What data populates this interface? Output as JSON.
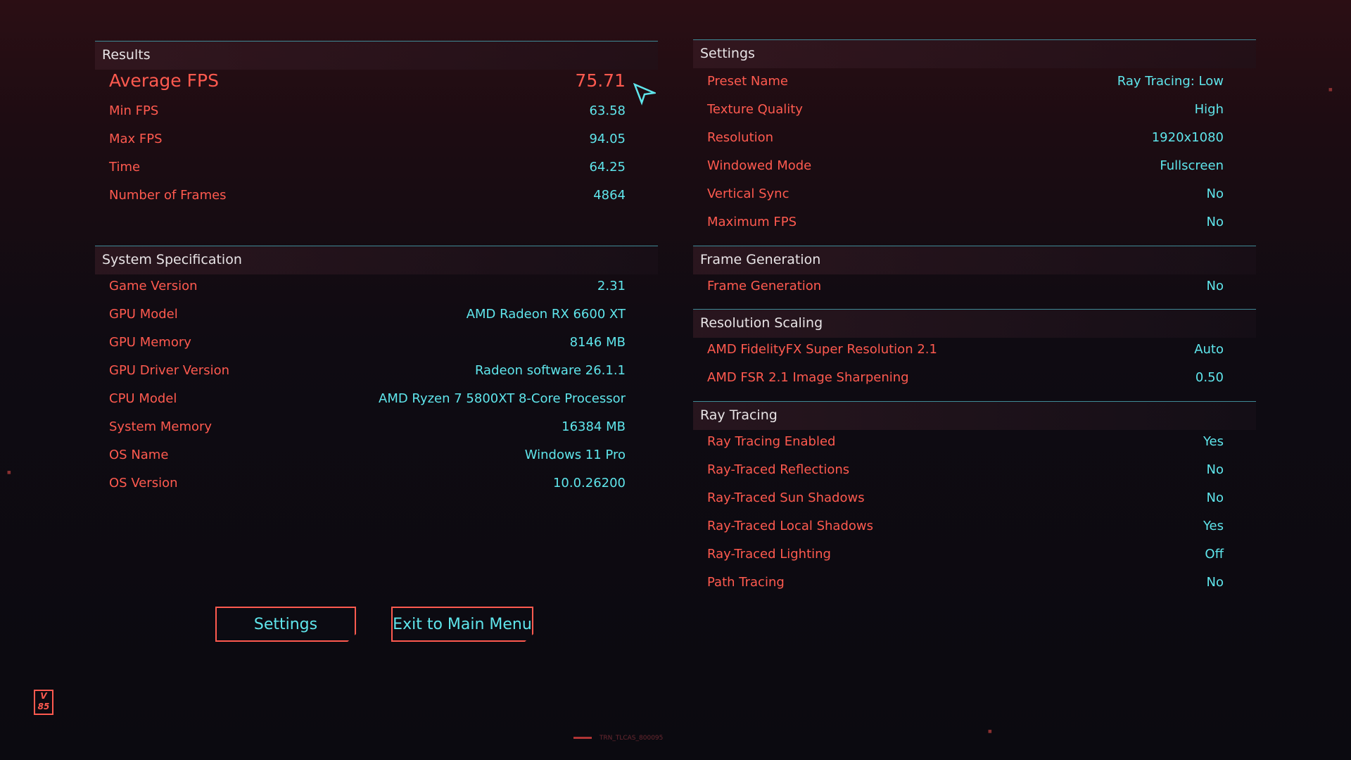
{
  "results": {
    "title": "Results",
    "average": {
      "label": "Average FPS",
      "value": "75.71"
    },
    "rows": [
      {
        "label": "Min FPS",
        "value": "63.58"
      },
      {
        "label": "Max FPS",
        "value": "94.05"
      },
      {
        "label": "Time",
        "value": "64.25"
      },
      {
        "label": "Number of Frames",
        "value": "4864"
      }
    ]
  },
  "system": {
    "title": "System Specification",
    "rows": [
      {
        "label": "Game Version",
        "value": "2.31"
      },
      {
        "label": "GPU Model",
        "value": "AMD Radeon RX 6600 XT"
      },
      {
        "label": "GPU Memory",
        "value": "8146 MB"
      },
      {
        "label": "GPU Driver Version",
        "value": "Radeon software 26.1.1"
      },
      {
        "label": "CPU Model",
        "value": "AMD Ryzen 7 5800XT 8-Core Processor"
      },
      {
        "label": "System Memory",
        "value": "16384 MB"
      },
      {
        "label": "OS Name",
        "value": "Windows 11 Pro"
      },
      {
        "label": "OS Version",
        "value": "10.0.26200"
      }
    ]
  },
  "settings": {
    "title": "Settings",
    "rows": [
      {
        "label": "Preset Name",
        "value": "Ray Tracing: Low"
      },
      {
        "label": "Texture Quality",
        "value": "High"
      },
      {
        "label": "Resolution",
        "value": "1920x1080"
      },
      {
        "label": "Windowed Mode",
        "value": "Fullscreen"
      },
      {
        "label": "Vertical Sync",
        "value": "No"
      },
      {
        "label": "Maximum FPS",
        "value": "No"
      }
    ]
  },
  "frame_generation": {
    "title": "Frame Generation",
    "rows": [
      {
        "label": "Frame Generation",
        "value": "No"
      }
    ]
  },
  "resolution_scaling": {
    "title": "Resolution Scaling",
    "rows": [
      {
        "label": "AMD FidelityFX Super Resolution 2.1",
        "value": "Auto"
      },
      {
        "label": "AMD FSR 2.1 Image Sharpening",
        "value": "0.50"
      }
    ]
  },
  "ray_tracing": {
    "title": "Ray Tracing",
    "rows": [
      {
        "label": "Ray Tracing Enabled",
        "value": "Yes"
      },
      {
        "label": "Ray-Traced Reflections",
        "value": "No"
      },
      {
        "label": "Ray-Traced Sun Shadows",
        "value": "No"
      },
      {
        "label": "Ray-Traced Local Shadows",
        "value": "Yes"
      },
      {
        "label": "Ray-Traced Lighting",
        "value": "Off"
      },
      {
        "label": "Path Tracing",
        "value": "No"
      }
    ]
  },
  "buttons": {
    "settings": "Settings",
    "exit": "Exit to Main Menu"
  },
  "footer": {
    "logo_text": "V 85",
    "code": "TRN_TLCAS_800095"
  },
  "colors": {
    "label_red": "#ff5a4f",
    "value_cyan": "#5fe6ec",
    "header_line": "#3f8a96"
  }
}
